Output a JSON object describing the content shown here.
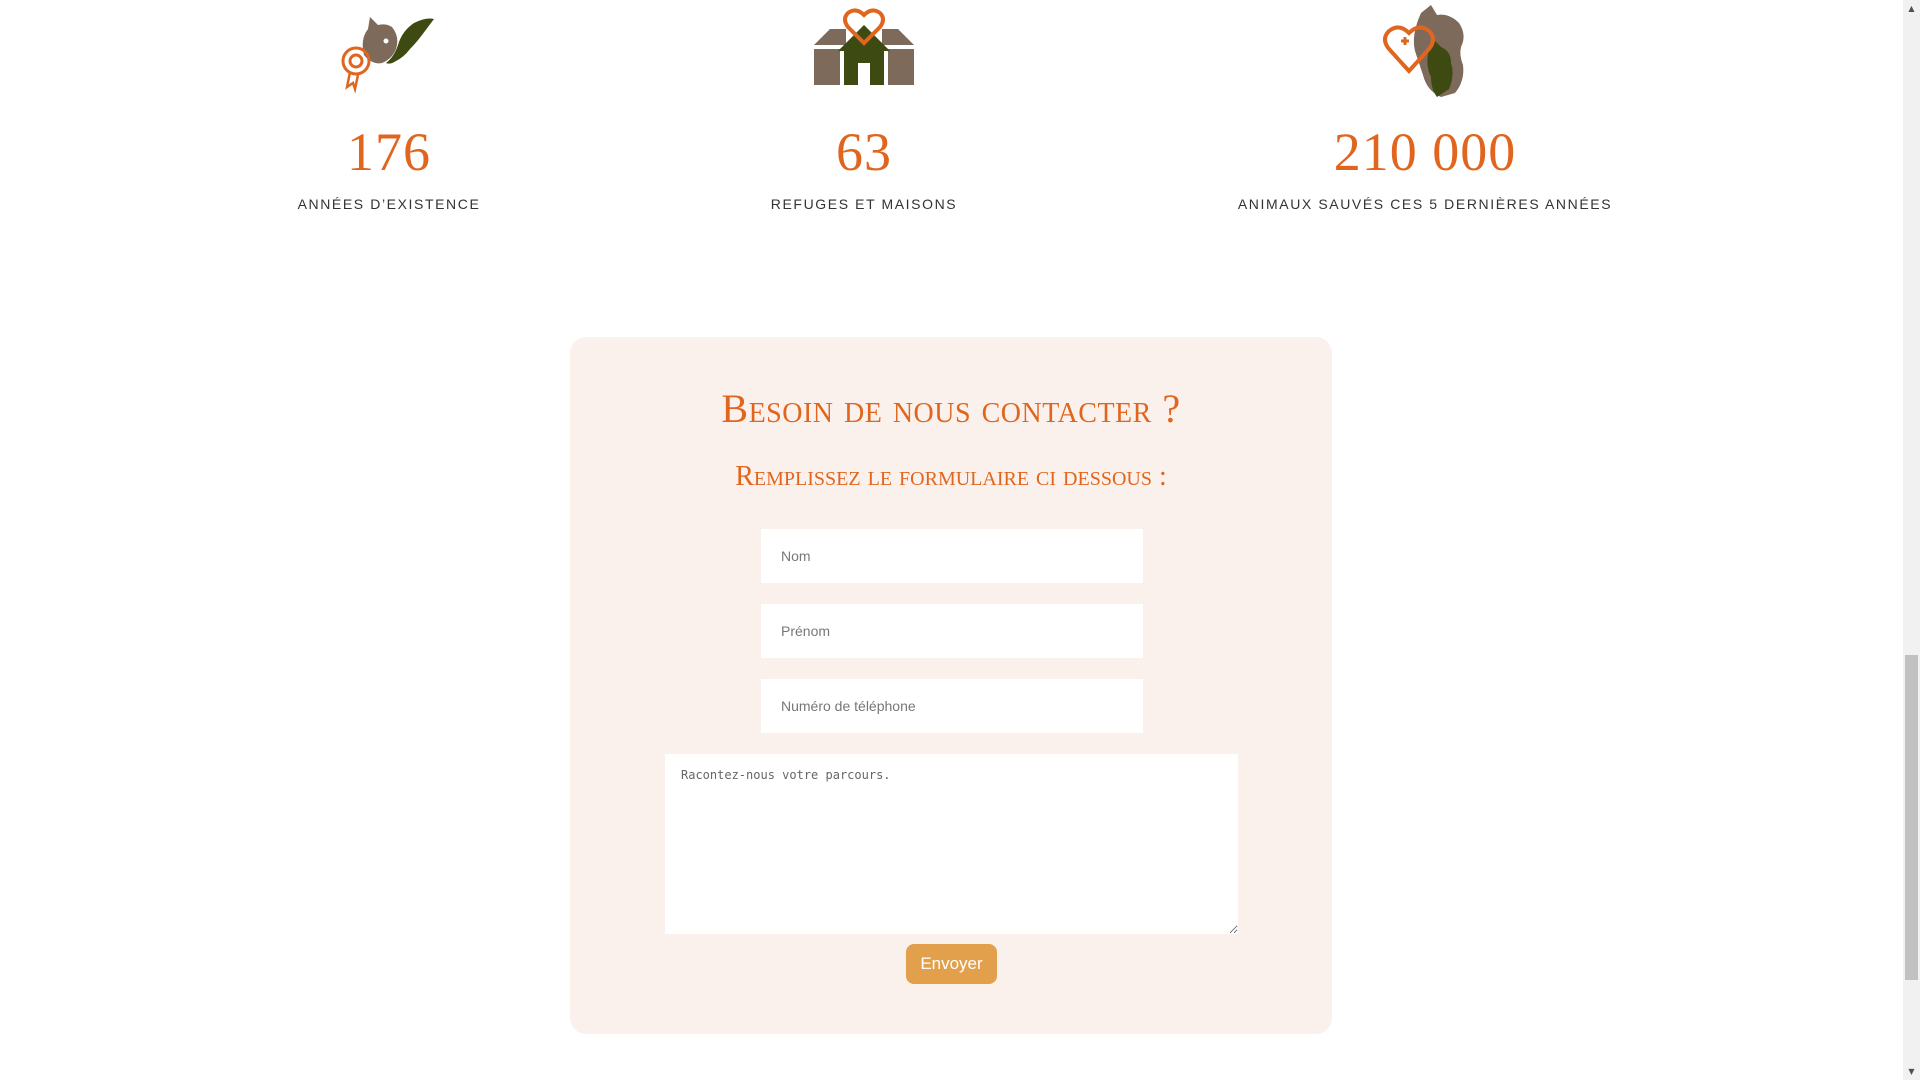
{
  "stats": [
    {
      "value": "176",
      "label": "ANNÉES D’EXISTENCE",
      "icon": "cat-award-hand-icon"
    },
    {
      "value": "63",
      "label": "REFUGES ET MAISONS",
      "icon": "shelter-houses-heart-icon"
    },
    {
      "value": "210 000",
      "label": "ANIMAUX SAUVÉS CES 5 DERNIÈRES ANNÉES",
      "icon": "pets-health-heart-icon"
    }
  ],
  "contact": {
    "title": "Besoin de nous contacter ?",
    "subtitle": "Remplissez le formulaire ci dessous :",
    "fields": {
      "nom_placeholder": "Nom",
      "prenom_placeholder": "Prénom",
      "telephone_placeholder": "Numéro de téléphone",
      "message_placeholder": "Racontez-nous votre parcours."
    },
    "submit_label": "Envoyer"
  },
  "colors": {
    "accent_orange": "#e0661f",
    "brown": "#7d6a5a",
    "dark_green": "#3d4a12",
    "card_bg": "#fbf1ec",
    "button_bg": "#e3a04c"
  }
}
